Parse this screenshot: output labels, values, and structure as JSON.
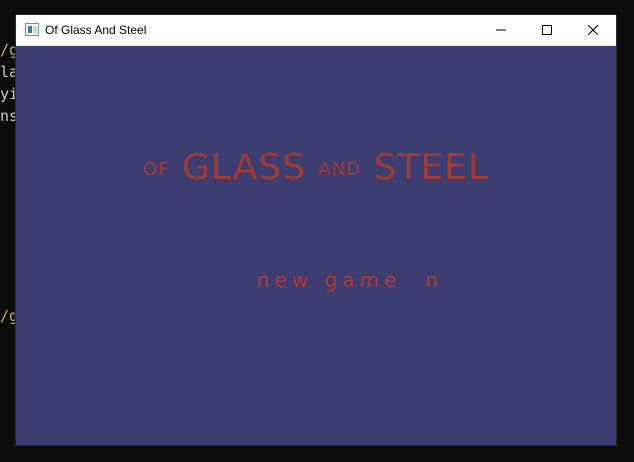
{
  "terminal": {
    "lines": [
      {
        "text": "/g",
        "color": "#c8b46a"
      },
      {
        "text": "la",
        "color": "#cccccc"
      },
      {
        "text": "yi",
        "color": "#cccccc"
      },
      {
        "text": "ns",
        "color": "#cccccc"
      },
      {
        "text": "/g",
        "color": "#c8b46a"
      }
    ]
  },
  "window": {
    "title": "Of Glass And Steel",
    "controls": {
      "minimize_icon": "minimize-icon",
      "maximize_icon": "maximize-icon",
      "close_icon": "close-icon"
    }
  },
  "game": {
    "background_color": "#3c3d70",
    "text_color": "#a13b36",
    "title_small_left": "OF",
    "title_large_left": "GLASS",
    "title_small_middle": "AND",
    "title_large_right": "STEEL",
    "menu": {
      "label": "new game",
      "key": "n"
    }
  }
}
